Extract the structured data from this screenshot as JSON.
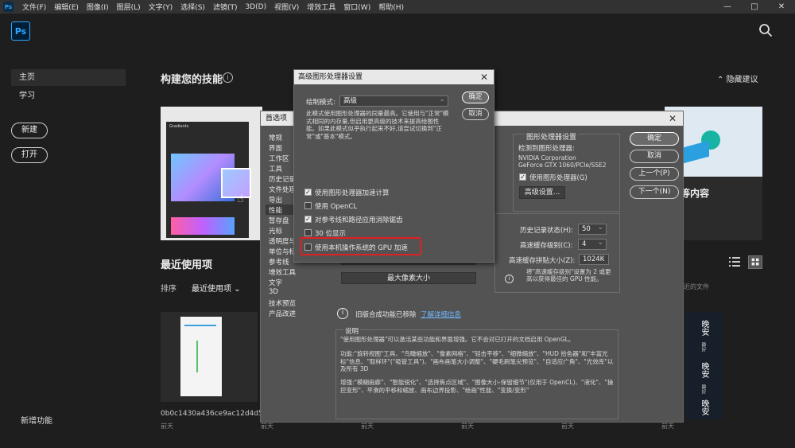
{
  "menu": {
    "app_icon": "Ps",
    "items": [
      "文件(F)",
      "编辑(E)",
      "图像(I)",
      "图层(L)",
      "文字(Y)",
      "选择(S)",
      "滤镜(T)",
      "3D(D)",
      "视图(V)",
      "增效工具",
      "窗口(W)",
      "帮助(H)"
    ],
    "window_controls": [
      "—",
      "□",
      "✕"
    ]
  },
  "app": {
    "logo": "Ps"
  },
  "sidebar": {
    "items": [
      "主页",
      "学习"
    ],
    "new_button": "新建",
    "open_button": "打开",
    "new_features": "新增功能"
  },
  "main": {
    "skills_title": "构建您的技能",
    "hide_suggestions": "隐藏建议",
    "card_partial_text": "等内容",
    "card_gradients": "Gradients",
    "recent_title": "最近使用项",
    "sort_label": "排序",
    "sort_value": "最近使用项",
    "file_partial_text": "近的文件",
    "files": [
      {
        "name": "0b0c1430a436ce9ac12d4d5...",
        "date": "前天"
      },
      {
        "name": "",
        "date": "前天"
      },
      {
        "name": "",
        "date": "前天"
      },
      {
        "name": "",
        "date": "前天"
      },
      {
        "name": "",
        "date": "前天"
      },
      {
        "name": "",
        "date": "前天"
      }
    ],
    "poster_text": "晚安",
    "poster_sub": "静好"
  },
  "preferences": {
    "title": "首选项",
    "categories": [
      "常规",
      "界面",
      "工作区",
      "工具",
      "历史记录",
      "文件处理",
      "导出",
      "性能",
      "暂存盘",
      "光标",
      "透明度与",
      "单位与标",
      "参考线",
      "增效工具",
      "文字",
      "3D",
      "技术预览",
      "产品改进"
    ],
    "buttons": [
      "确定",
      "取消",
      "上一个(P)",
      "下一个(N)"
    ],
    "gpu_section_title": "图形处理器设置",
    "gpu_detected_label": "检测到图形处理器:",
    "gpu_vendor": "NVIDIA Corporation",
    "gpu_model": "GeForce GTX 1060/PCIe/SSE2",
    "use_gpu_label": "使用图形处理器(G)",
    "advanced_button": "高级设置...",
    "history_label": "历史记录状态(H):",
    "history_value": "50",
    "cache_levels_label": "高速缓存级别(C):",
    "cache_levels_value": "4",
    "cache_tile_label": "高速缓存拼贴大小(Z):",
    "cache_tile_value": "1024K",
    "cache_hint": "将\"高速缓存级别\"设置为 2 或更高以获得最佳的 GPU 性能。",
    "max_pixel_button": "最大像素大小",
    "legacy_notice": "旧版合成功能已移除",
    "learn_more": "了解详细信息",
    "desc_title": "说明",
    "desc_1": "\"使用图形处理器\"可以激活某些功能和界面增强。它不会对已打开的文档启用 OpenGL。",
    "desc_2": "功能:\"旋转视图\"工具、\"鸟瞰缩放\"、\"像素网格\"、\"轻击平移\"、\"细微缩放\"、\"HUD 拾色器\"和\"丰富光标\"信息、\"取样环\"(\"吸管工具\")、\"画布画笔大小调整\"、\"硬毛刷笔尖预览\"、\"自适应广角\"、\"光效库\"以及所有 3D",
    "desc_3": "增强:\"模糊画廊\"、\"智能锐化\"、\"选择焦点区域\"、\"图像大小-保留细节\"(仅用于 OpenCL)、\"液化\"、\"操控变形\"、平滑的平移和缩放、画布边界投影、\"绘画\"性能、\"变换/变形\""
  },
  "gpu_dialog": {
    "title": "高级图形处理器设置",
    "mode_label": "绘制模式:",
    "mode_value": "高级",
    "mode_desc": "此模式使用图形处理器的同量最高。它使用与\"正常\"模式相同的内存量,但启用更高级的技术来提高绘图性能。如果此模式似乎执行起来不好,请尝试切换到\"正常\"或\"基本\"模式。",
    "ok": "确定",
    "cancel": "取消",
    "options": [
      {
        "label": "使用图形处理器加速计算",
        "checked": true
      },
      {
        "label": "使用 OpenCL",
        "checked": false
      },
      {
        "label": "对参考线和路径应用消除锯齿",
        "checked": true
      },
      {
        "label": "30 位显示",
        "checked": false
      },
      {
        "label": "使用本机操作系统的 GPU 加速",
        "checked": false
      }
    ]
  },
  "colors": {
    "highlight": "#e02020",
    "ps_blue": "#31a8ff"
  }
}
